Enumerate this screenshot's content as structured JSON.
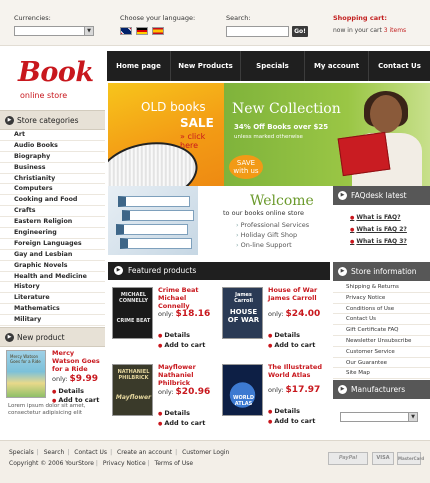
{
  "header": {
    "currencies_label": "Currencies:",
    "language_label": "Choose your language:",
    "search_label": "Search:",
    "search_button": "Go!",
    "cart_title": "Shopping cart:",
    "cart_prefix": "now in your cart",
    "cart_items": "3 items"
  },
  "logo": {
    "title": "Book",
    "subtitle": "online store"
  },
  "nav": [
    "Home page",
    "New Products",
    "Specials",
    "My account",
    "Contact Us"
  ],
  "categories": {
    "title": "Store categories",
    "items": [
      "Art",
      "Audio Books",
      "Biography",
      "Business",
      "Christianity",
      "Computers",
      "Cooking and Food",
      "Crafts",
      "Eastern Religion",
      "Engineering",
      "Foreign Languages",
      "Gay and Lesbian",
      "Graphic Novels",
      "Health and Medicine",
      "History",
      "Literature",
      "Mathematics",
      "Military"
    ]
  },
  "new_product": {
    "title": "New product",
    "name": "Mercy Watson Goes for a Ride",
    "price_label": "only:",
    "price": "$9.99",
    "details": "Details",
    "add": "Add to cart",
    "cover_text": "Mercy Watson Goes for a Ride",
    "description": "Lorem ipsum dolor sit amet, consectetur adipisicing elit"
  },
  "banners": {
    "old_line1": "OLD books",
    "old_line2": "SALE",
    "old_click": "» click here",
    "new_title": "New Collection",
    "new_offer": "34% Off Books over $25",
    "new_note": "unless marked otherwise",
    "save_badge_1": "SAVE",
    "save_badge_2": "with us"
  },
  "welcome": {
    "title": "Welcome",
    "subtitle": "to our books online store",
    "links": [
      "Professional Services",
      "Holiday Gift Shop",
      "On-line Support"
    ]
  },
  "faq": {
    "title": "FAQdesk latest",
    "items": [
      "What is FAQ?",
      "What is FAQ 2?",
      "What is FAQ 3?"
    ]
  },
  "store_info": {
    "title": "Store information",
    "items": [
      "Shipping & Returns",
      "Privacy Notice",
      "Conditions of Use",
      "Contact Us",
      "Gift Certificate FAQ",
      "Newsletter Unsubscribe",
      "Customer Service",
      "Our Guarantee",
      "Site Map"
    ]
  },
  "manufacturers": {
    "title": "Manufacturers"
  },
  "featured": {
    "title": "Featured products",
    "price_label": "only:",
    "details": "Details",
    "add": "Add to cart",
    "products": [
      {
        "name": "Crime Beat Michael Connelly",
        "price": "$18.16",
        "cover_author": "MICHAEL CONNELLY",
        "cover_title": "CRIME BEAT",
        "cover_color": "#1a1a1a",
        "text_color": "#e9e9e9"
      },
      {
        "name": "House of War James Carroll",
        "price": "$24.00",
        "cover_author": "James Carroll",
        "cover_title": "HOUSE OF WAR",
        "cover_color": "#2a3a55",
        "text_color": "#ffffff"
      },
      {
        "name": "Mayflower Nathaniel Philbrick",
        "price": "$20.96",
        "cover_author": "NATHANIEL PHILBRICK",
        "cover_title": "Mayflower",
        "cover_color": "#3a3a2a",
        "text_color": "#e8d9a0"
      },
      {
        "name": "The Illustrated World Atlas",
        "price": "$17.97",
        "cover_author": "",
        "cover_title": "WORLD ATLAS",
        "cover_color": "#0d1f45",
        "text_color": "#ffffff"
      }
    ]
  },
  "footer": {
    "links": [
      "Specials",
      "Search",
      "Contact Us",
      "Create an account",
      "Customer Login"
    ],
    "copyright_links": [
      "Copyright © 2006 YourStore",
      "Privacy Notice",
      "Terms of Use"
    ],
    "payments": [
      "PayPal",
      "VISA",
      "MasterCard"
    ]
  },
  "colors": {
    "accent": "#c8171d",
    "nav_bg": "#1f1f1f",
    "green": "#7fb33b",
    "orange": "#f39c15"
  }
}
